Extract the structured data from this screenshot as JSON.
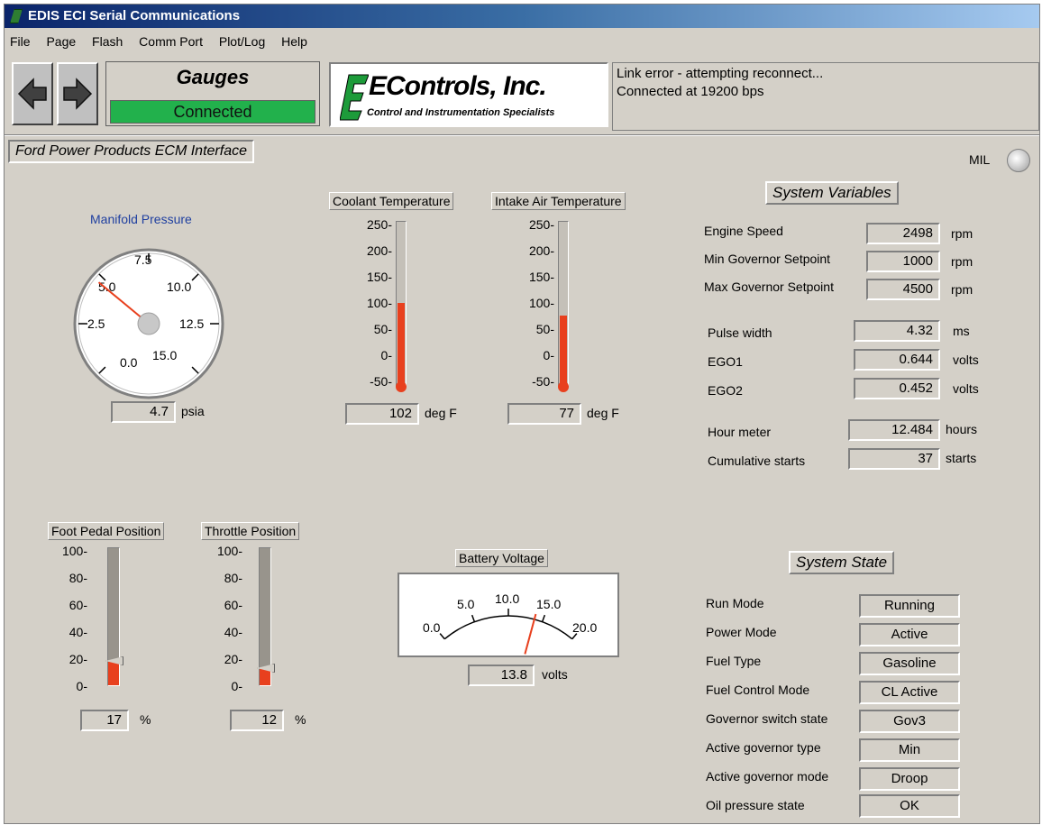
{
  "window": {
    "title": "EDIS ECI Serial Communications"
  },
  "menu": [
    "File",
    "Page",
    "Flash",
    "Comm Port",
    "Plot/Log",
    "Help"
  ],
  "page": {
    "name": "Gauges",
    "connection": "Connected"
  },
  "logo": {
    "company": "EControls, Inc.",
    "tagline": "Control and Instrumentation Specialists"
  },
  "status_lines": [
    "Link error - attempting reconnect...",
    "Connected at 19200 bps"
  ],
  "panel_title": "Ford Power Products ECM Interface",
  "mil_label": "MIL",
  "manifold": {
    "title": "Manifold Pressure",
    "value": "4.7",
    "unit": "psia",
    "reading": 4.7,
    "scale_labels": [
      "0.0",
      "2.5",
      "5.0",
      "7.5",
      "10.0",
      "12.5",
      "15.0"
    ]
  },
  "coolant": {
    "title": "Coolant Temperature",
    "value": "102",
    "unit": "deg F",
    "reading": 102
  },
  "intake": {
    "title": "Intake Air Temperature",
    "value": "77",
    "unit": "deg F",
    "reading": 77
  },
  "temp_scale": [
    "250-",
    "200-",
    "150-",
    "100-",
    "50-",
    "0-",
    "-50-"
  ],
  "foot_pedal": {
    "title": "Foot Pedal Position",
    "value": "17",
    "unit": "%",
    "reading": 17
  },
  "throttle": {
    "title": "Throttle Position",
    "value": "12",
    "unit": "%",
    "reading": 12
  },
  "pct_scale": [
    "100-",
    "80-",
    "60-",
    "40-",
    "20-",
    "0-"
  ],
  "battery": {
    "title": "Battery Voltage",
    "value": "13.8",
    "unit": "volts",
    "reading": 13.8,
    "scale_labels": [
      "0.0",
      "5.0",
      "10.0",
      "15.0",
      "20.0"
    ]
  },
  "system_variables": {
    "title": "System Variables",
    "rows": [
      {
        "label": "Engine Speed",
        "value": "2498",
        "unit": "rpm"
      },
      {
        "label": "Min Governor Setpoint",
        "value": "1000",
        "unit": "rpm"
      },
      {
        "label": "Max Governor Setpoint",
        "value": "4500",
        "unit": "rpm"
      },
      {
        "label": "Pulse width",
        "value": "4.32",
        "unit": "ms"
      },
      {
        "label": "EGO1",
        "value": "0.644",
        "unit": "volts"
      },
      {
        "label": "EGO2",
        "value": "0.452",
        "unit": "volts"
      },
      {
        "label": "Hour meter",
        "value": "12.484",
        "unit": "hours"
      },
      {
        "label": "Cumulative starts",
        "value": "37",
        "unit": "starts"
      }
    ]
  },
  "system_state": {
    "title": "System State",
    "rows": [
      {
        "label": "Run Mode",
        "value": "Running"
      },
      {
        "label": "Power Mode",
        "value": "Active"
      },
      {
        "label": "Fuel Type",
        "value": "Gasoline"
      },
      {
        "label": "Fuel Control Mode",
        "value": "CL Active"
      },
      {
        "label": "Governor switch state",
        "value": "Gov3"
      },
      {
        "label": "Active governor type",
        "value": "Min"
      },
      {
        "label": "Active governor mode",
        "value": "Droop"
      },
      {
        "label": "Oil pressure state",
        "value": "OK"
      }
    ]
  },
  "colors": {
    "connected": "#22b14c",
    "fill": "#e8401e",
    "title_bar": "#0a246a"
  }
}
